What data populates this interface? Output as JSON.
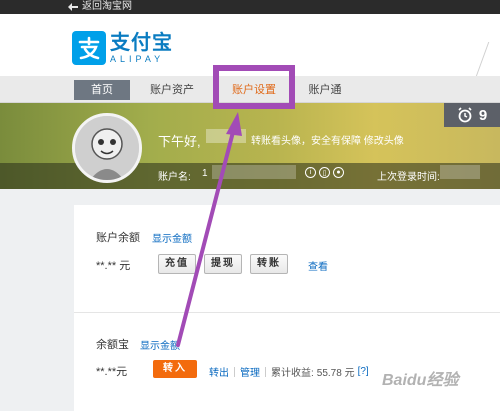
{
  "topbar": {
    "back_label": "返回淘宝网"
  },
  "logo": {
    "name": "支付宝",
    "en": "ALIPAY"
  },
  "nav": {
    "items": [
      {
        "label": "首页",
        "active": true
      },
      {
        "label": "账户资产",
        "active": false
      },
      {
        "label": "账户设置",
        "active": false
      },
      {
        "label": "账户通",
        "active": false
      }
    ]
  },
  "profile": {
    "greeting": "下午好,",
    "tip": "转账看头像，安全有保障 修改头像",
    "account_label": "账户名:",
    "account_value": "1",
    "last_login_label": "上次登录时间:",
    "notification_count": "9"
  },
  "balance": {
    "label": "账户余额",
    "show_amount": "显示金额",
    "amount": "**.** 元",
    "recharge": "充值",
    "withdraw": "提现",
    "transfer": "转账",
    "view": "查看"
  },
  "yuebao": {
    "label": "余额宝",
    "show_amount": "显示金额",
    "amount": "**.**元",
    "transfer_in": "转入",
    "transfer_out": "转出",
    "manage": "管理",
    "income_label": "累计收益:",
    "income_value": "55.78 元",
    "help": "[?]"
  },
  "watermark": "Baidu经验",
  "colors": {
    "highlight": "#a24bb6",
    "accent": "#f36b0d",
    "brand": "#00a0e9"
  }
}
